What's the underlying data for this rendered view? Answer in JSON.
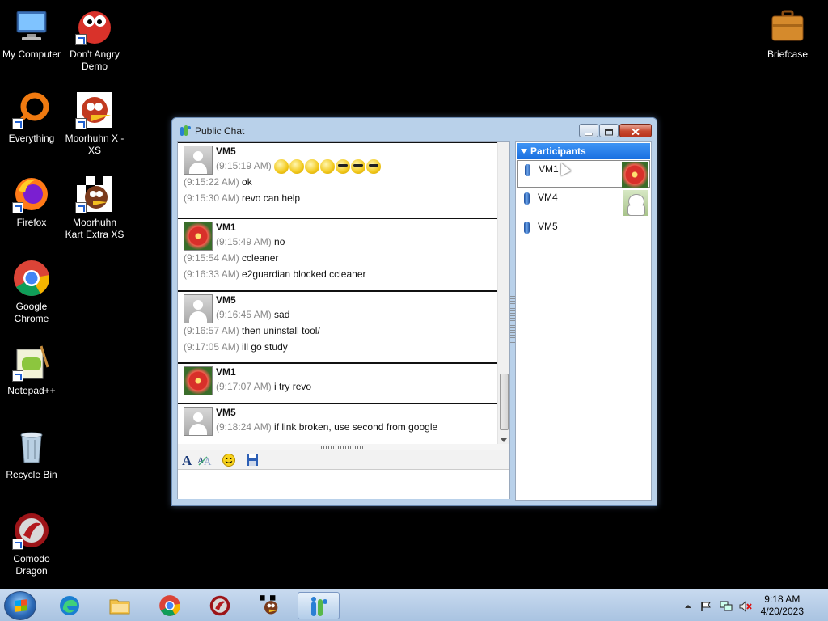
{
  "desktop": {
    "icons": [
      {
        "label": "My Computer"
      },
      {
        "label": "Don't Angry Demo"
      },
      {
        "label": "Everything"
      },
      {
        "label": "Moorhuhn X - XS"
      },
      {
        "label": "Firefox"
      },
      {
        "label": "Moorhuhn Kart Extra XS"
      },
      {
        "label": "Google Chrome"
      },
      {
        "label": "Notepad++"
      },
      {
        "label": "Recycle Bin"
      },
      {
        "label": "Comodo Dragon"
      },
      {
        "label": "Briefcase"
      }
    ]
  },
  "window": {
    "title": "Public Chat",
    "messages": [
      {
        "sender": "VM5",
        "lines": [
          {
            "time": "(9:15:19 AM)",
            "text": ""
          },
          {
            "time": "(9:15:22 AM)",
            "text": "ok"
          },
          {
            "time": "(9:15:30 AM)",
            "text": "revo can help"
          }
        ]
      },
      {
        "sender": "VM1",
        "lines": [
          {
            "time": "(9:15:49 AM)",
            "text": "no"
          },
          {
            "time": "(9:15:54 AM)",
            "text": "ccleaner"
          },
          {
            "time": "(9:16:33 AM)",
            "text": "e2guardian blocked ccleaner"
          }
        ]
      },
      {
        "sender": "VM5",
        "lines": [
          {
            "time": "(9:16:45 AM)",
            "text": "sad"
          },
          {
            "time": "(9:16:57 AM)",
            "text": "then uninstall tool/"
          },
          {
            "time": "(9:17:05 AM)",
            "text": "ill go study"
          }
        ]
      },
      {
        "sender": "VM1",
        "lines": [
          {
            "time": "(9:17:07 AM)",
            "text": "i try revo"
          }
        ]
      },
      {
        "sender": "VM5",
        "lines": [
          {
            "time": "(9:18:24 AM)",
            "text": "if link broken, use second from google"
          }
        ]
      }
    ],
    "participants_header": "Participants",
    "participants": [
      {
        "name": "VM1"
      },
      {
        "name": "VM4"
      },
      {
        "name": "VM5"
      }
    ]
  },
  "taskbar": {
    "time": "9:18 AM",
    "date": "4/20/2023"
  }
}
